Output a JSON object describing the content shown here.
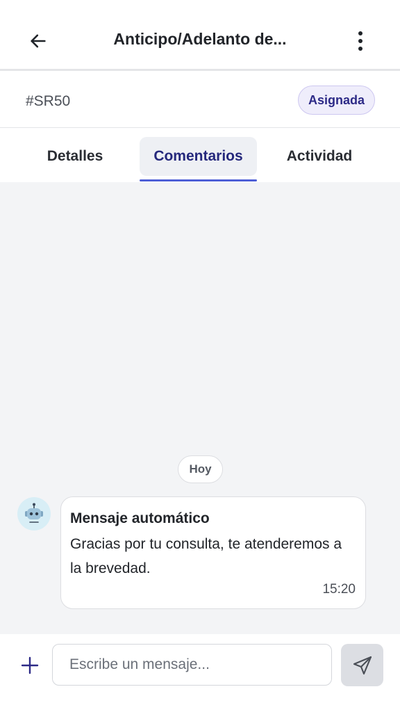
{
  "header": {
    "title": "Anticipo/Adelanto de...",
    "back_icon": "arrow-left-icon",
    "more_icon": "more-vertical-icon"
  },
  "ticket": {
    "id": "#SR50",
    "status": "Asignada",
    "status_color": "#2d2a87"
  },
  "tabs": [
    {
      "label": "Detalles",
      "active": false
    },
    {
      "label": "Comentarios",
      "active": true
    },
    {
      "label": "Actividad",
      "active": false
    }
  ],
  "chat": {
    "date_label": "Hoy",
    "messages": [
      {
        "avatar_icon": "robot-icon",
        "sender": "Mensaje automático",
        "text": "Gracias por tu consulta, te atenderemos a la brevedad.",
        "time": "15:20"
      }
    ]
  },
  "composer": {
    "placeholder": "Escribe un mensaje...",
    "value": "",
    "add_icon": "plus-icon",
    "send_icon": "send-icon"
  },
  "colors": {
    "accent": "#4e5fd6",
    "background": "#f3f4f6"
  }
}
